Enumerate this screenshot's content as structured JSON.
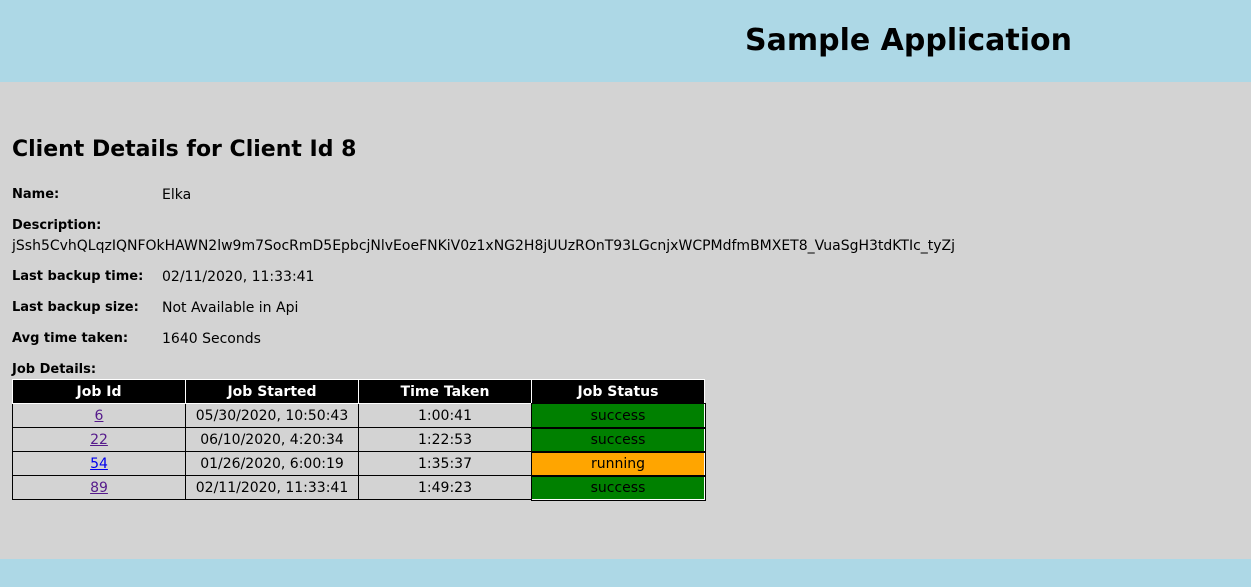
{
  "header": {
    "title": "Sample Application",
    "bg_color": "#add8e6"
  },
  "page": {
    "title": "Client Details for Client Id 8"
  },
  "client": {
    "name_label": "Name:",
    "name_value": "Elka",
    "description_label": "Description:",
    "description_value": "jSsh5CvhQLqzIQNFOkHAWN2lw9m7SocRmD5EpbcjNlvEoeFNKiV0z1xNG2H8jUUzROnT93LGcnjxWCPMdfmBMXET8_VuaSgH3tdKTIc_tyZj",
    "last_backup_time_label": "Last backup time:",
    "last_backup_time_value": "02/11/2020, 11:33:41",
    "last_backup_size_label": "Last backup size:",
    "last_backup_size_value": "Not Available in Api",
    "avg_time_label": "Avg time taken:",
    "avg_time_value": "1640 Seconds"
  },
  "jobs": {
    "label": "Job Details:",
    "columns": [
      "Job Id",
      "Job Started",
      "Time Taken",
      "Job Status"
    ],
    "rows": [
      {
        "id": "6",
        "started": "05/30/2020, 10:50:43",
        "taken": "1:00:41",
        "status": "success",
        "status_color": "#008000"
      },
      {
        "id": "22",
        "started": "06/10/2020, 4:20:34",
        "taken": "1:22:53",
        "status": "success",
        "status_color": "#008000"
      },
      {
        "id": "54",
        "started": "01/26/2020, 6:00:19",
        "taken": "1:35:37",
        "status": "running",
        "status_color": "#ffa500"
      },
      {
        "id": "89",
        "started": "02/11/2020, 11:33:41",
        "taken": "1:49:23",
        "status": "success",
        "status_color": "#008000"
      }
    ]
  }
}
